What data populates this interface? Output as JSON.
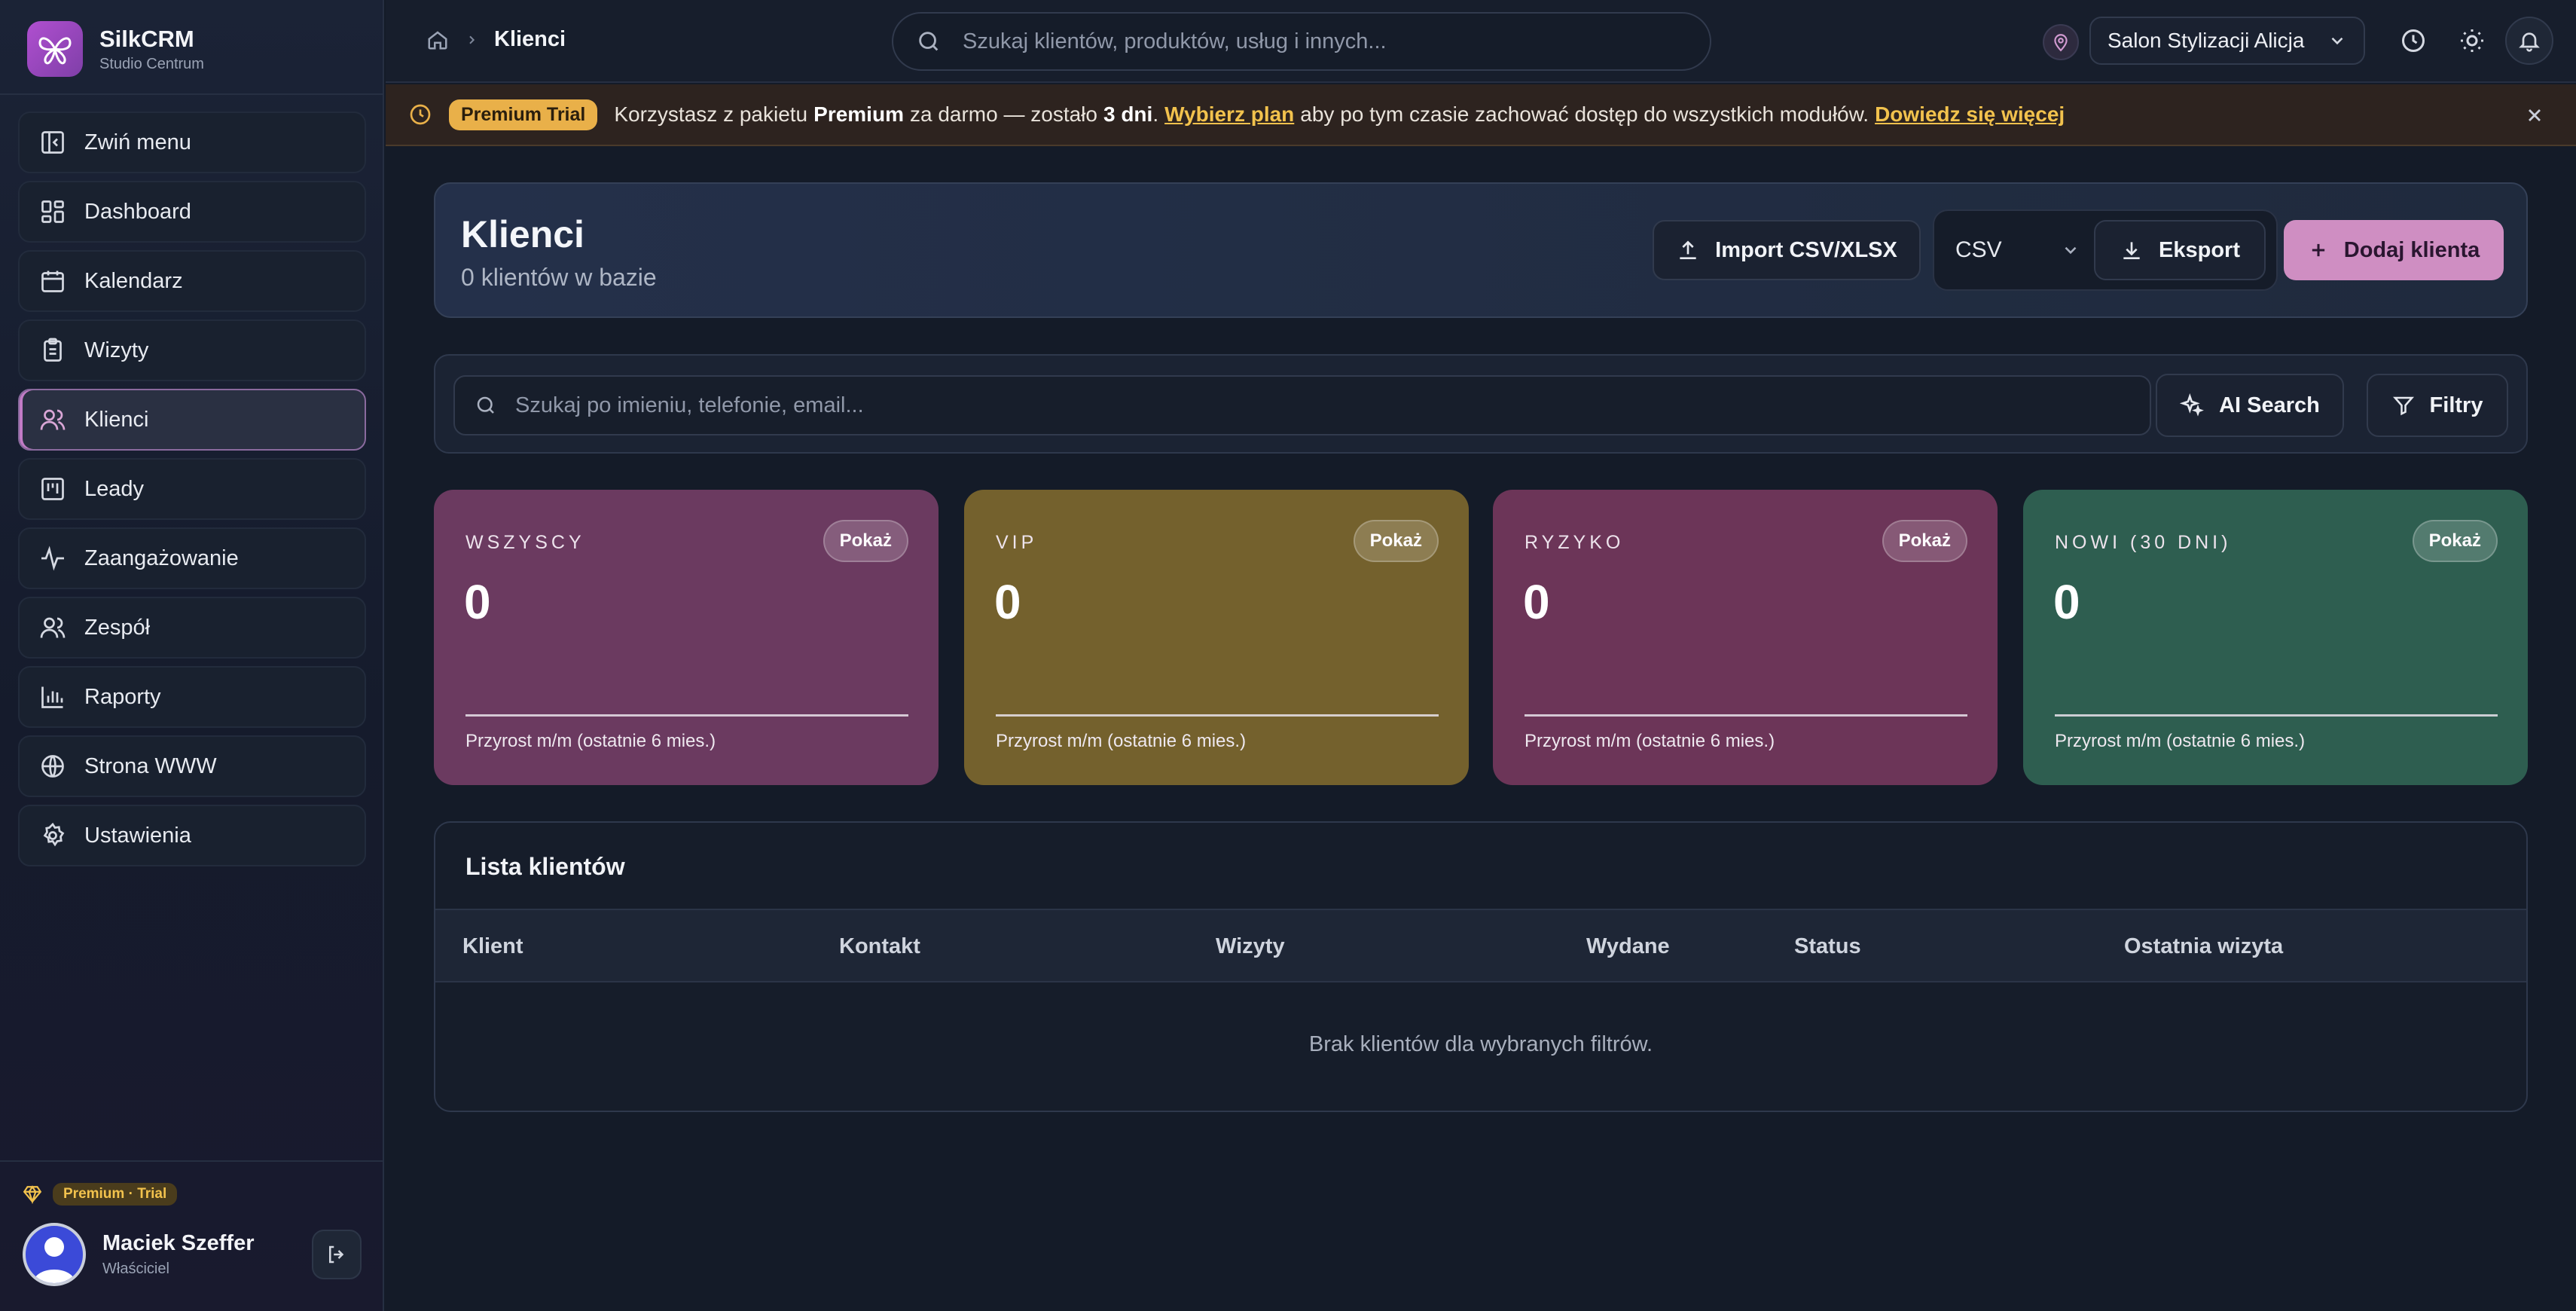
{
  "brand": {
    "name": "SilkCRM",
    "subtitle": "Studio Centrum"
  },
  "sidebar": {
    "items": [
      {
        "label": "Zwiń menu",
        "icon": "collapse-icon"
      },
      {
        "label": "Dashboard",
        "icon": "dashboard-icon"
      },
      {
        "label": "Kalendarz",
        "icon": "calendar-icon"
      },
      {
        "label": "Wizyty",
        "icon": "clipboard-icon"
      },
      {
        "label": "Klienci",
        "icon": "users-icon",
        "active": true
      },
      {
        "label": "Leady",
        "icon": "kanban-icon"
      },
      {
        "label": "Zaangażowanie",
        "icon": "activity-icon"
      },
      {
        "label": "Zespół",
        "icon": "team-icon"
      },
      {
        "label": "Raporty",
        "icon": "chart-icon"
      },
      {
        "label": "Strona WWW",
        "icon": "globe-icon"
      },
      {
        "label": "Ustawienia",
        "icon": "gear-icon"
      }
    ],
    "plan_badge": "Premium · Trial",
    "user": {
      "name": "Maciek Szeffer",
      "role": "Właściciel"
    }
  },
  "topbar": {
    "breadcrumb": "Klienci",
    "search_placeholder": "Szukaj klientów, produktów, usług i innych...",
    "salon": "Salon Stylizacji Alicja"
  },
  "banner": {
    "pill": "Premium Trial",
    "text_1": "Korzystasz z pakietu",
    "bold_1": "Premium",
    "text_2": "za darmo — zostało",
    "bold_2": "3 dni",
    "text_3": ".",
    "link_1": "Wybierz plan",
    "text_4": "aby po tym czasie zachować dostęp do wszystkich modułów.",
    "link_2": "Dowiedz się więcej"
  },
  "header": {
    "title": "Klienci",
    "count": "0 klientów w bazie",
    "import_label": "Import CSV/XLSX",
    "format_value": "CSV",
    "export_label": "Eksport",
    "add_label": "Dodaj klienta"
  },
  "list_search": {
    "placeholder": "Szukaj po imieniu, telefonie, email...",
    "ai_label": "AI Search",
    "filters_label": "Filtry"
  },
  "stats": [
    {
      "label": "WSZYSCY",
      "value": "0",
      "show": "Pokaż",
      "foot": "Przyrost m/m (ostatnie 6 mies.)",
      "color": "#6b3a60"
    },
    {
      "label": "VIP",
      "value": "0",
      "show": "Pokaż",
      "foot": "Przyrost m/m (ostatnie 6 mies.)",
      "color": "#74612d"
    },
    {
      "label": "RYZYKO",
      "value": "0",
      "show": "Pokaż",
      "foot": "Przyrost m/m (ostatnie 6 mies.)",
      "color": "#6c3558"
    },
    {
      "label": "NOWI (30 DNI)",
      "value": "0",
      "show": "Pokaż",
      "foot": "Przyrost m/m (ostatnie 6 mies.)",
      "color": "#2e5e50"
    }
  ],
  "client_list": {
    "title": "Lista klientów",
    "columns": [
      "Klient",
      "Kontakt",
      "Wizyty",
      "Wydane",
      "Status",
      "Ostatnia wizyta"
    ],
    "empty": "Brak klientów dla wybranych filtrów."
  },
  "colors": {
    "accent": "#cf8ec2",
    "warning": "#f2c24d",
    "background": "#141b28"
  }
}
